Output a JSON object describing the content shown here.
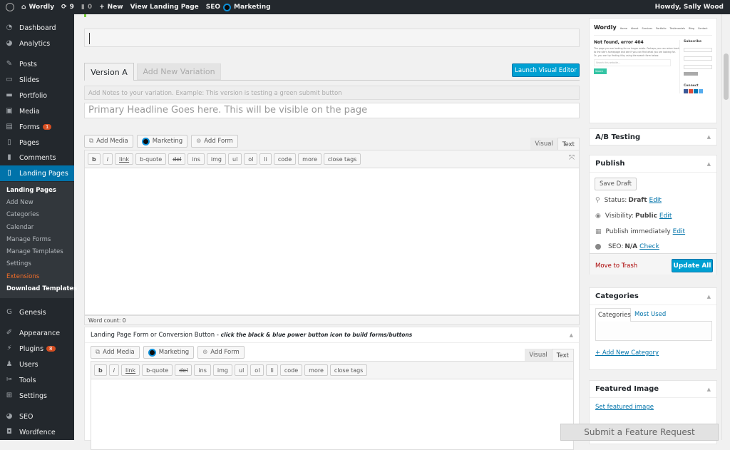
{
  "adminbar": {
    "site": "Wordly",
    "updates": "9",
    "comments": "0",
    "new": "New",
    "view": "View Landing Page",
    "seo": "SEO",
    "marketing": "Marketing",
    "howdy": "Howdy, Sally Wood"
  },
  "sidebar": {
    "items": [
      {
        "label": "Dashboard",
        "icon": "dashboard-icon"
      },
      {
        "label": "Analytics",
        "icon": "analytics-icon"
      },
      {
        "label": "Posts",
        "icon": "pin-icon"
      },
      {
        "label": "Slides",
        "icon": "slides-icon"
      },
      {
        "label": "Portfolio",
        "icon": "folder-icon"
      },
      {
        "label": "Media",
        "icon": "media-icon"
      },
      {
        "label": "Forms",
        "icon": "forms-icon",
        "badge": "1"
      },
      {
        "label": "Pages",
        "icon": "pages-icon"
      },
      {
        "label": "Comments",
        "icon": "comments-icon"
      },
      {
        "label": "Landing Pages",
        "icon": "landing-pages-icon"
      },
      {
        "label": "Genesis",
        "icon": "genesis-icon"
      },
      {
        "label": "Appearance",
        "icon": "brush-icon"
      },
      {
        "label": "Plugins",
        "icon": "plug-icon",
        "badge": "8"
      },
      {
        "label": "Users",
        "icon": "users-icon"
      },
      {
        "label": "Tools",
        "icon": "wrench-icon"
      },
      {
        "label": "Settings",
        "icon": "settings-icon"
      },
      {
        "label": "SEO",
        "icon": "seo-icon"
      },
      {
        "label": "Wordfence",
        "icon": "shield-icon"
      }
    ],
    "submenu": [
      "Landing Pages",
      "Add New",
      "Categories",
      "Calendar",
      "Manage Forms",
      "Manage Templates",
      "Settings",
      "Extensions",
      "Download Templates"
    ]
  },
  "main": {
    "tabs": [
      "Version A",
      "Add New Variation"
    ],
    "launch": "Launch Visual Editor",
    "notes_placeholder": "Add Notes to your variation. Example: This version is testing a green submit button",
    "headline_placeholder": "Primary Headline Goes here. This will be visible on the page",
    "media": [
      "Add Media",
      "Marketing",
      "Add Form"
    ],
    "modes": [
      "Visual",
      "Text"
    ],
    "quicktags": [
      "b",
      "i",
      "link",
      "b-quote",
      "del",
      "ins",
      "img",
      "ul",
      "ol",
      "li",
      "code",
      "more",
      "close tags"
    ],
    "word_count": "Word count: 0",
    "form_box_title": "Landing Page Form or Conversion Button - ",
    "form_box_hint": "click the black & blue power button icon to build forms/buttons"
  },
  "preview": {
    "logo": "Wordly",
    "nav": [
      "Home",
      "About",
      "Services",
      "Portfolio",
      "Testimonials",
      "Blog",
      "Contact"
    ],
    "heading": "Not found, error 404",
    "body": "The page you are looking for no longer exists. Perhaps you can return back to the site's homepage and see if you can find what you are looking for. Or, you can try finding it by using the search form below.",
    "search_placeholder": "Search this website...",
    "search": "Search",
    "subscribe": "Subscribe",
    "connect": "Connect"
  },
  "ab": {
    "title": "A/B Testing"
  },
  "publish": {
    "title": "Publish",
    "save": "Save Draft",
    "status_label": "Status:",
    "status": "Draft",
    "visibility_label": "Visibility:",
    "visibility": "Public",
    "immediately": "Publish immediately",
    "seo_label": "SEO:",
    "seo": "N/A",
    "edit": "Edit",
    "check": "Check",
    "trash": "Move to Trash",
    "update": "Update All"
  },
  "categories": {
    "title": "Categories",
    "tabs": [
      "Categories",
      "Most Used"
    ],
    "add": "+ Add New Category"
  },
  "featured": {
    "title": "Featured Image",
    "set": "Set featured image"
  },
  "feature_request": "Submit a Feature Request",
  "colors": {
    "accent": "#0073aa",
    "button": "#00a0d2",
    "bar": "#23282d"
  }
}
